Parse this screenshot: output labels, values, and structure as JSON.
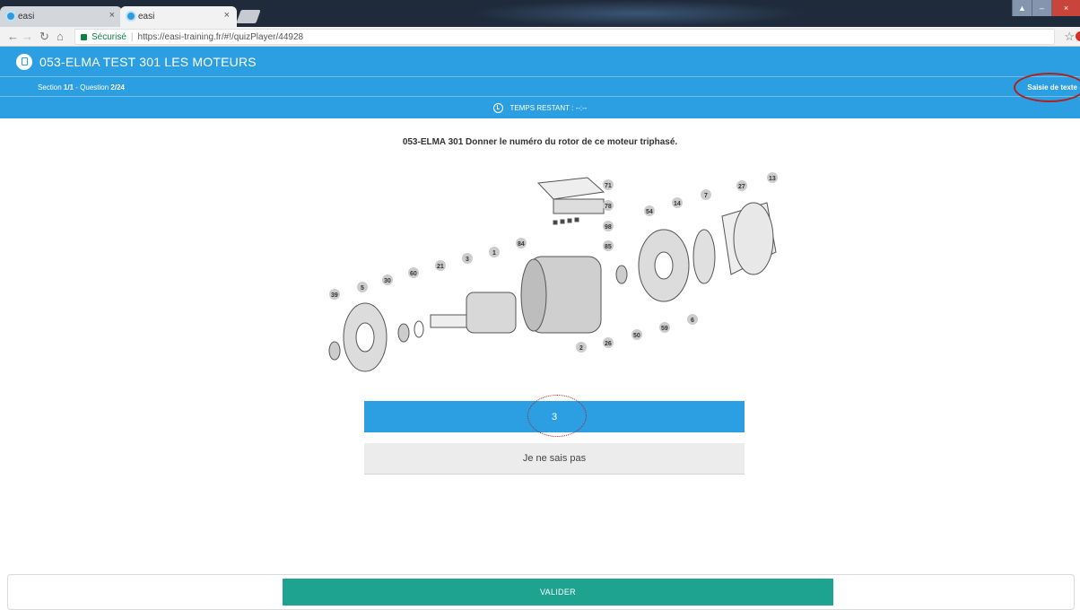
{
  "browser": {
    "tabs": [
      {
        "title": "easi",
        "close": "×"
      },
      {
        "title": "easi",
        "close": "×"
      }
    ],
    "address": {
      "secure_label": "Sécurisé",
      "separator": "|",
      "url": "https://easi-training.fr/#!/quizPlayer/44928"
    },
    "star_glyph": "☆"
  },
  "header": {
    "title": "053-ELMA TEST 301 LES MOTEURS",
    "section_prefix": "Section ",
    "section_value": "1/1",
    "question_prefix": " - Question ",
    "question_value": "2/24",
    "mode_label": "Saisie de texte",
    "timer_label": "TEMPS RESTANT : --:--"
  },
  "question": {
    "text": "053-ELMA 301 Donner le numéro du rotor de ce moteur triphasé.",
    "diagram_labels": [
      "71",
      "78",
      "98",
      "85",
      "84",
      "1",
      "3",
      "21",
      "60",
      "30",
      "5",
      "39",
      "2",
      "26",
      "50",
      "59",
      "6",
      "54",
      "14",
      "7",
      "27",
      "13"
    ]
  },
  "answer": {
    "value": "3",
    "dont_know_label": "Je ne sais pas"
  },
  "footer": {
    "validate_label": "VALIDER"
  },
  "colors": {
    "header_blue": "#2b9fe2",
    "validate_green": "#1fa391",
    "annotation_red": "#b0201d"
  }
}
